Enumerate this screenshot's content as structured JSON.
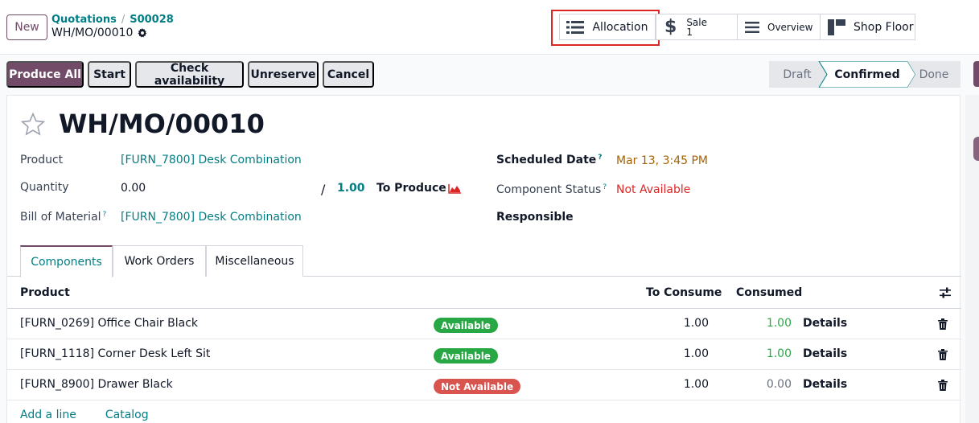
{
  "topbar": {
    "new_label": "New",
    "breadcrumb": [
      "Quotations",
      "S00028"
    ],
    "record": "WH/MO/00010",
    "smart_buttons": {
      "allocation": "Allocation",
      "sale_label": "Sale",
      "sale_count": "1",
      "overview": "Overview",
      "shop_floor": "Shop Floor"
    }
  },
  "actions": {
    "produce_all": "Produce All",
    "start": "Start",
    "check_availability": "Check availability",
    "unreserve": "Unreserve",
    "cancel": "Cancel"
  },
  "status": {
    "stages": [
      "Draft",
      "Confirmed",
      "Done"
    ],
    "current": "Confirmed"
  },
  "form": {
    "title": "WH/MO/00010",
    "product_label": "Product",
    "product_value": "[FURN_7800] Desk Combination",
    "quantity_label": "Quantity",
    "quantity_value": "0.00",
    "quantity_sep": "/",
    "quantity_target": "1.00",
    "to_produce_label": "To Produce",
    "bom_label": "Bill of Material",
    "bom_value": "[FURN_7800] Desk Combination",
    "scheduled_label": "Scheduled Date",
    "scheduled_value": "Mar 13, 3:45 PM",
    "component_status_label": "Component Status",
    "component_status_value": "Not Available",
    "responsible_label": "Responsible",
    "help_mark": "?"
  },
  "tabs": [
    "Components",
    "Work Orders",
    "Miscellaneous"
  ],
  "table": {
    "headers": {
      "product": "Product",
      "to_consume": "To Consume",
      "consumed": "Consumed"
    },
    "rows": [
      {
        "product": "[FURN_0269] Office Chair Black",
        "status": "Available",
        "to_consume": "1.00",
        "consumed": "1.00",
        "details": "Details"
      },
      {
        "product": "[FURN_1118] Corner Desk Left Sit",
        "status": "Available",
        "to_consume": "1.00",
        "consumed": "1.00",
        "details": "Details"
      },
      {
        "product": "[FURN_8900] Drawer Black",
        "status": "Not Available",
        "to_consume": "1.00",
        "consumed": "0.00",
        "details": "Details"
      }
    ],
    "add_line": "Add a line",
    "catalog": "Catalog"
  },
  "colors": {
    "brand": "#714b67",
    "link": "#017e84",
    "available": "#28a745",
    "not_available": "#d9534f",
    "highlight": "#dc2626"
  }
}
